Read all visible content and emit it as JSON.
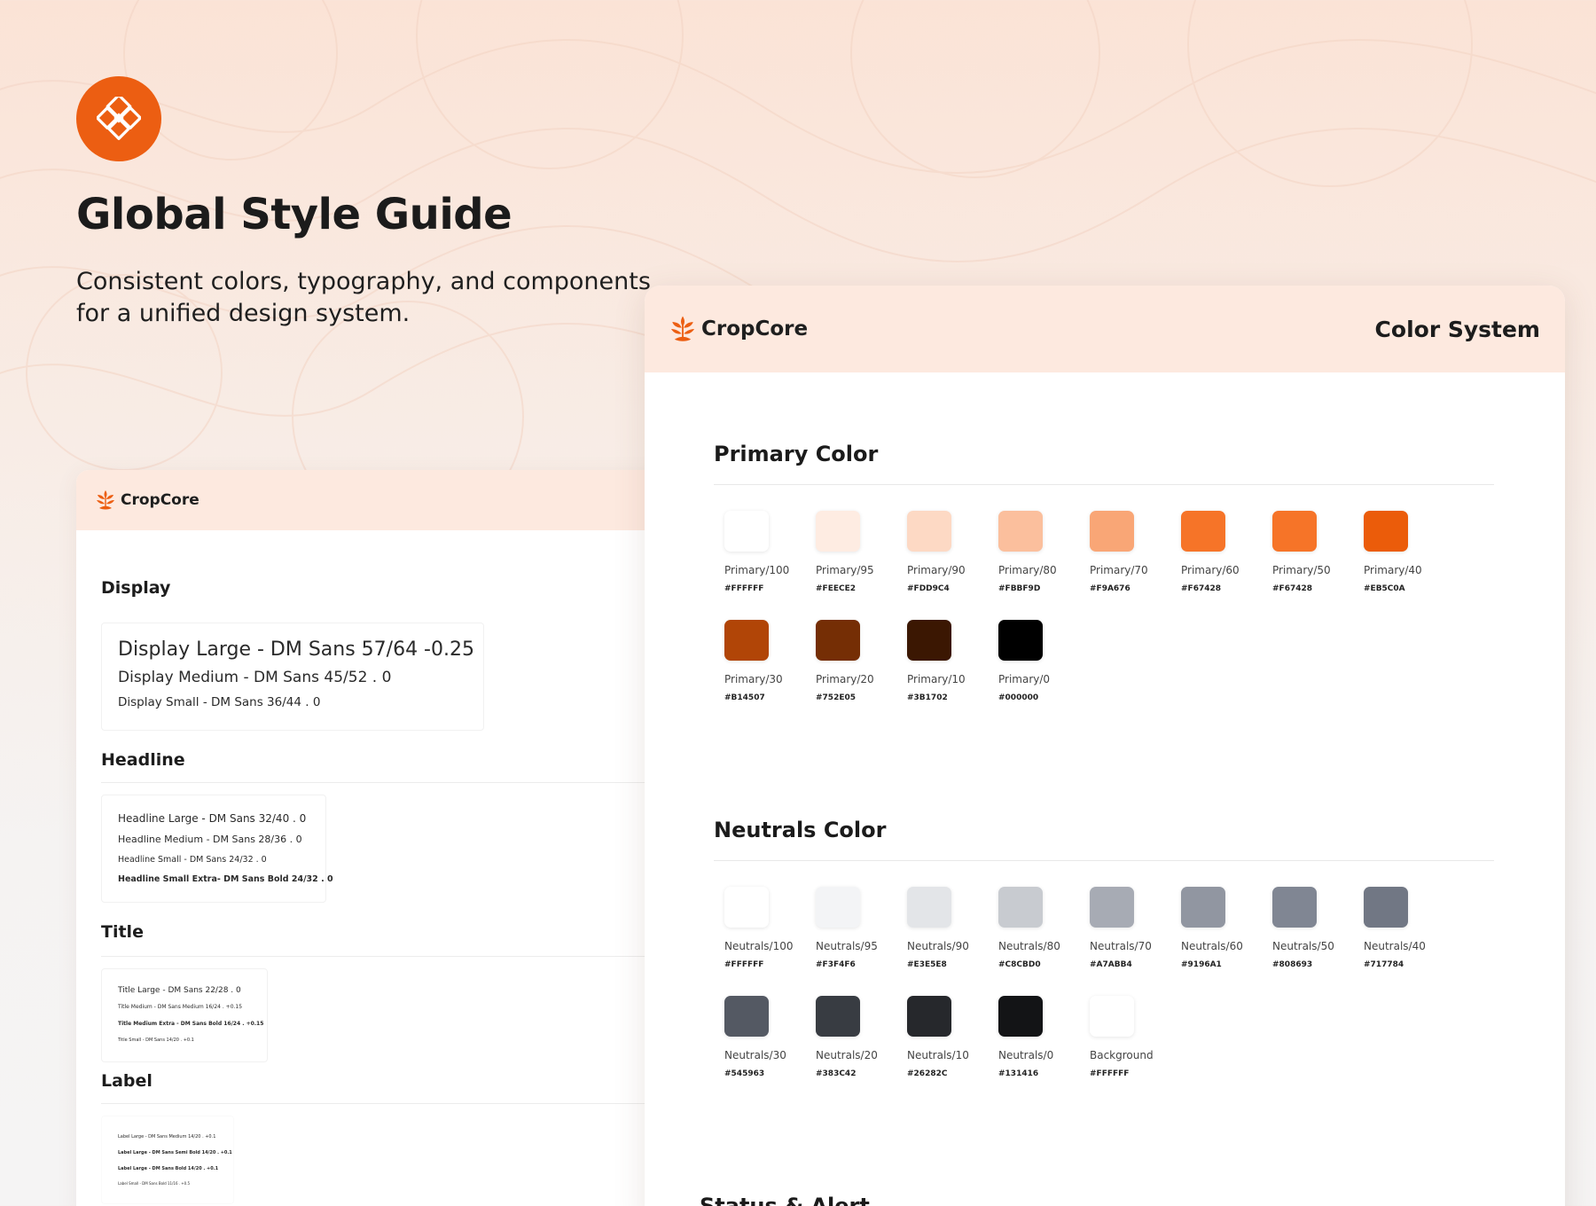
{
  "hero": {
    "title": "Global Style Guide",
    "subtitle": "Consistent colors, typography, and components for a unified design system."
  },
  "brand": {
    "name": "CropCore",
    "accent": "#EC5E12",
    "header_bg": "#FDE9DF"
  },
  "typography_card": {
    "sections": [
      {
        "heading": "Display",
        "lines": [
          "Display Large - DM Sans 57/64 -0.25",
          "Display Medium - DM Sans 45/52 .  0",
          "Display Small - DM Sans 36/44 . 0"
        ]
      },
      {
        "heading": "Headline",
        "lines": [
          "Headline Large - DM Sans 32/40 . 0",
          "Headline Medium - DM Sans 28/36 . 0",
          "Headline Small - DM Sans 24/32 . 0",
          "Headline Small Extra- DM Sans Bold 24/32 . 0"
        ]
      },
      {
        "heading": "Title",
        "lines": [
          "Title Large - DM Sans  22/28 . 0",
          "Title Medium - DM Sans Medium 16/24 . +0.15",
          "Title Medium Extra - DM Sans Bold 16/24 . +0.15",
          "Title Small - DM Sans 14/20 . +0.1"
        ]
      },
      {
        "heading": "Label",
        "lines": [
          "Label Large - DM Sans Medium 14/20 . +0.1",
          "Label Large - DM Sans Semi Bold 14/20 . +0.1",
          "Label Large - DM Sans Bold 14/20 . +0.1",
          "Label Small - DM Sans Bold 11/16 . +0.5"
        ]
      }
    ]
  },
  "color_card": {
    "title": "Color System",
    "primary": {
      "heading": "Primary Color",
      "swatches": [
        {
          "name": "Primary/100",
          "hex": "#FFFFFF"
        },
        {
          "name": "Primary/95",
          "hex": "#FEECE2"
        },
        {
          "name": "Primary/90",
          "hex": "#FDD9C4"
        },
        {
          "name": "Primary/80",
          "hex": "#FBBF9D"
        },
        {
          "name": "Primary/70",
          "hex": "#F9A676"
        },
        {
          "name": "Primary/60",
          "hex": "#F67428"
        },
        {
          "name": "Primary/50",
          "hex": "#F67428"
        },
        {
          "name": "Primary/40",
          "hex": "#EB5C0A"
        },
        {
          "name": "Primary/30",
          "hex": "#B14507"
        },
        {
          "name": "Primary/20",
          "hex": "#752E05"
        },
        {
          "name": "Primary/10",
          "hex": "#3B1702"
        },
        {
          "name": "Primary/0",
          "hex": "#000000"
        }
      ]
    },
    "neutrals": {
      "heading": "Neutrals Color",
      "swatches": [
        {
          "name": "Neutrals/100",
          "hex": "#FFFFFF"
        },
        {
          "name": "Neutrals/95",
          "hex": "#F3F4F6"
        },
        {
          "name": "Neutrals/90",
          "hex": "#E3E5E8"
        },
        {
          "name": "Neutrals/80",
          "hex": "#C8CBD0"
        },
        {
          "name": "Neutrals/70",
          "hex": "#A7ABB4"
        },
        {
          "name": "Neutrals/60",
          "hex": "#9196A1"
        },
        {
          "name": "Neutrals/50",
          "hex": "#808693"
        },
        {
          "name": "Neutrals/40",
          "hex": "#717784"
        },
        {
          "name": "Neutrals/30",
          "hex": "#545963"
        },
        {
          "name": "Neutrals/20",
          "hex": "#383C42"
        },
        {
          "name": "Neutrals/10",
          "hex": "#26282C"
        },
        {
          "name": "Neutrals/0",
          "hex": "#131416"
        },
        {
          "name": "Background",
          "hex": "#FFFFFF"
        }
      ]
    },
    "status_heading": "Status & Alert"
  }
}
